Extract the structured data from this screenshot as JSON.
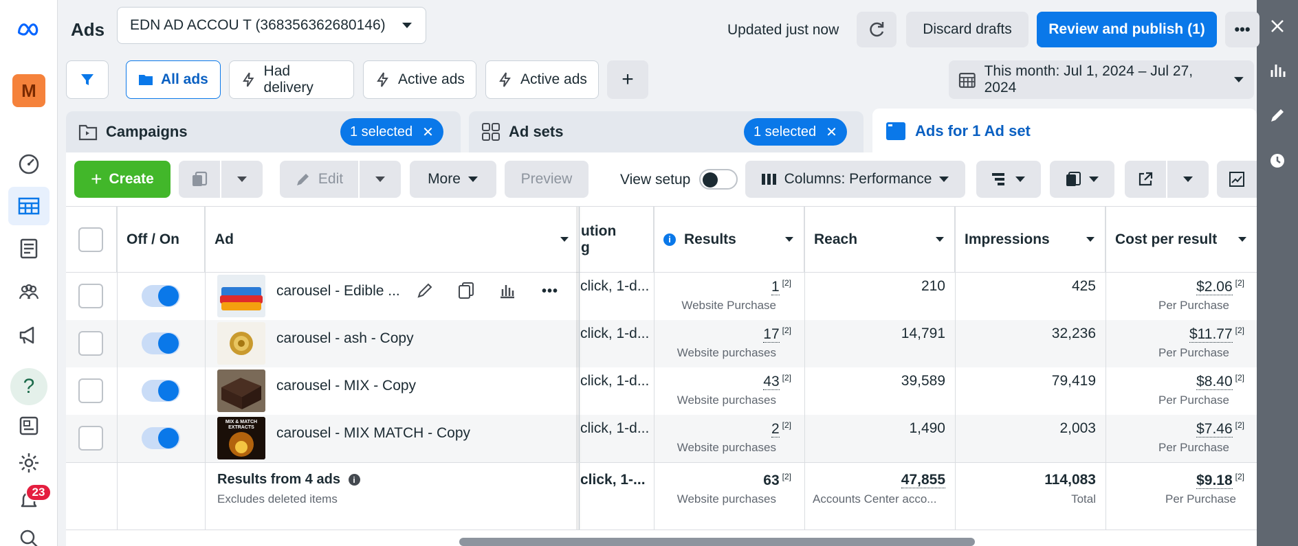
{
  "header": {
    "title": "Ads",
    "account": "EDN AD ACCOU T (368356362680146)",
    "updated": "Updated just now",
    "discard": "Discard drafts",
    "publish": "Review and publish (1)"
  },
  "rail": {
    "avatar_letter": "M",
    "help": "?",
    "notifications": "23"
  },
  "filters": {
    "all_ads": "All ads",
    "had_delivery": "Had delivery",
    "active_ads_1": "Active ads",
    "active_ads_2": "Active ads",
    "date_range": "This month: Jul 1, 2024 – Jul 27, 2024"
  },
  "tabs": {
    "campaigns": "Campaigns",
    "campaigns_selected": "1 selected",
    "adsets": "Ad sets",
    "adsets_selected": "1 selected",
    "ads": "Ads for 1 Ad set"
  },
  "toolbar": {
    "create": "Create",
    "edit": "Edit",
    "more": "More",
    "preview": "Preview",
    "view_setup": "View setup",
    "columns": "Columns: Performance"
  },
  "table": {
    "headers": {
      "off_on": "Off / On",
      "ad": "Ad",
      "attribution": "ution\ng",
      "results": "Results",
      "reach": "Reach",
      "impressions": "Impressions",
      "cost_per_result": "Cost per result"
    },
    "rows": [
      {
        "name": "carousel - Edible ...",
        "attribution": "click, 1-d...",
        "results": "1",
        "results_sub": "Website Purchase",
        "reach": "210",
        "impressions": "425",
        "cost": "$2.06",
        "cost_sub": "Per Purchase",
        "ref": "[2]"
      },
      {
        "name": "carousel - ash - Copy",
        "attribution": "click, 1-d...",
        "results": "17",
        "results_sub": "Website purchases",
        "reach": "14,791",
        "impressions": "32,236",
        "cost": "$11.77",
        "cost_sub": "Per Purchase",
        "ref": "[2]"
      },
      {
        "name": "carousel - MIX - Copy",
        "attribution": "click, 1-d...",
        "results": "43",
        "results_sub": "Website purchases",
        "reach": "39,589",
        "impressions": "79,419",
        "cost": "$8.40",
        "cost_sub": "Per Purchase",
        "ref": "[2]"
      },
      {
        "name": "carousel - MIX MATCH - Copy",
        "attribution": "click, 1-d...",
        "results": "2",
        "results_sub": "Website purchases",
        "reach": "1,490",
        "impressions": "2,003",
        "cost": "$7.46",
        "cost_sub": "Per Purchase",
        "ref": "[2]"
      }
    ],
    "totals": {
      "label": "Results from 4 ads",
      "sub": "Excludes deleted items",
      "attribution": "click, 1-...",
      "results": "63",
      "results_sub": "Website purchases",
      "reach": "47,855",
      "reach_sub": "Accounts Center acco...",
      "impressions": "114,083",
      "impressions_sub": "Total",
      "cost": "$9.18",
      "cost_sub": "Per Purchase",
      "ref": "[2]"
    },
    "thumb_caption": "MIX & MATCH EXTRACTS"
  },
  "colors": {
    "primary": "#0a78e9",
    "create_green": "#42b72a",
    "right_rail": "#606770"
  }
}
